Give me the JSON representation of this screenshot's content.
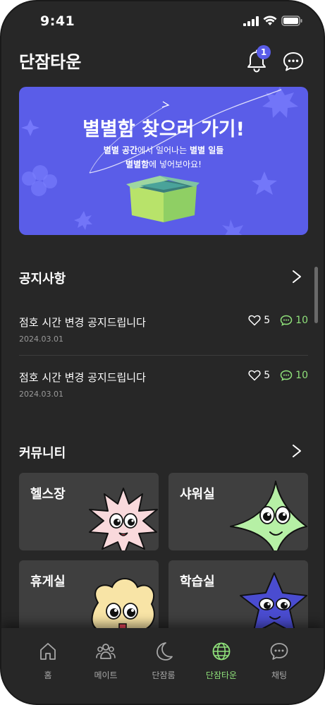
{
  "status_bar": {
    "time": "9:41"
  },
  "header": {
    "title": "단잠타운",
    "notification_count": "1"
  },
  "banner": {
    "title": "별별함 찾으러 가기!",
    "subtitle_line1_bold1": "별별 공간",
    "subtitle_line1_mid": "에서 일어나는 ",
    "subtitle_line1_bold2": "별별 일들",
    "subtitle_line2_bold": "별별함",
    "subtitle_line2_rest": "에 넣어보아요!"
  },
  "notices": {
    "section_title": "공지사항",
    "items": [
      {
        "title": "점호 시간 변경 공지드립니다",
        "date": "2024.03.01",
        "likes": "5",
        "comments": "10"
      },
      {
        "title": "점호 시간 변경 공지드립니다",
        "date": "2024.03.01",
        "likes": "5",
        "comments": "10"
      }
    ]
  },
  "community": {
    "section_title": "커뮤니티",
    "cards": [
      {
        "label": "헬스장",
        "mascot": "pink-spiky-mascot"
      },
      {
        "label": "샤워실",
        "mascot": "green-star-mascot"
      },
      {
        "label": "휴게실",
        "mascot": "yellow-blob-mascot"
      },
      {
        "label": "학습실",
        "mascot": "blue-star-mascot"
      }
    ]
  },
  "bottom_nav": {
    "active": "단잠타운",
    "items": [
      {
        "label": "홈",
        "icon": "home-icon"
      },
      {
        "label": "메이트",
        "icon": "people-icon"
      },
      {
        "label": "단잠룸",
        "icon": "moon-icon"
      },
      {
        "label": "단잠타운",
        "icon": "globe-icon"
      },
      {
        "label": "채팅",
        "icon": "chat-icon"
      }
    ]
  },
  "colors": {
    "background": "#272727",
    "accent_purple": "#5a5de8",
    "accent_green": "#8fe17a",
    "card": "#3f3f3f"
  }
}
